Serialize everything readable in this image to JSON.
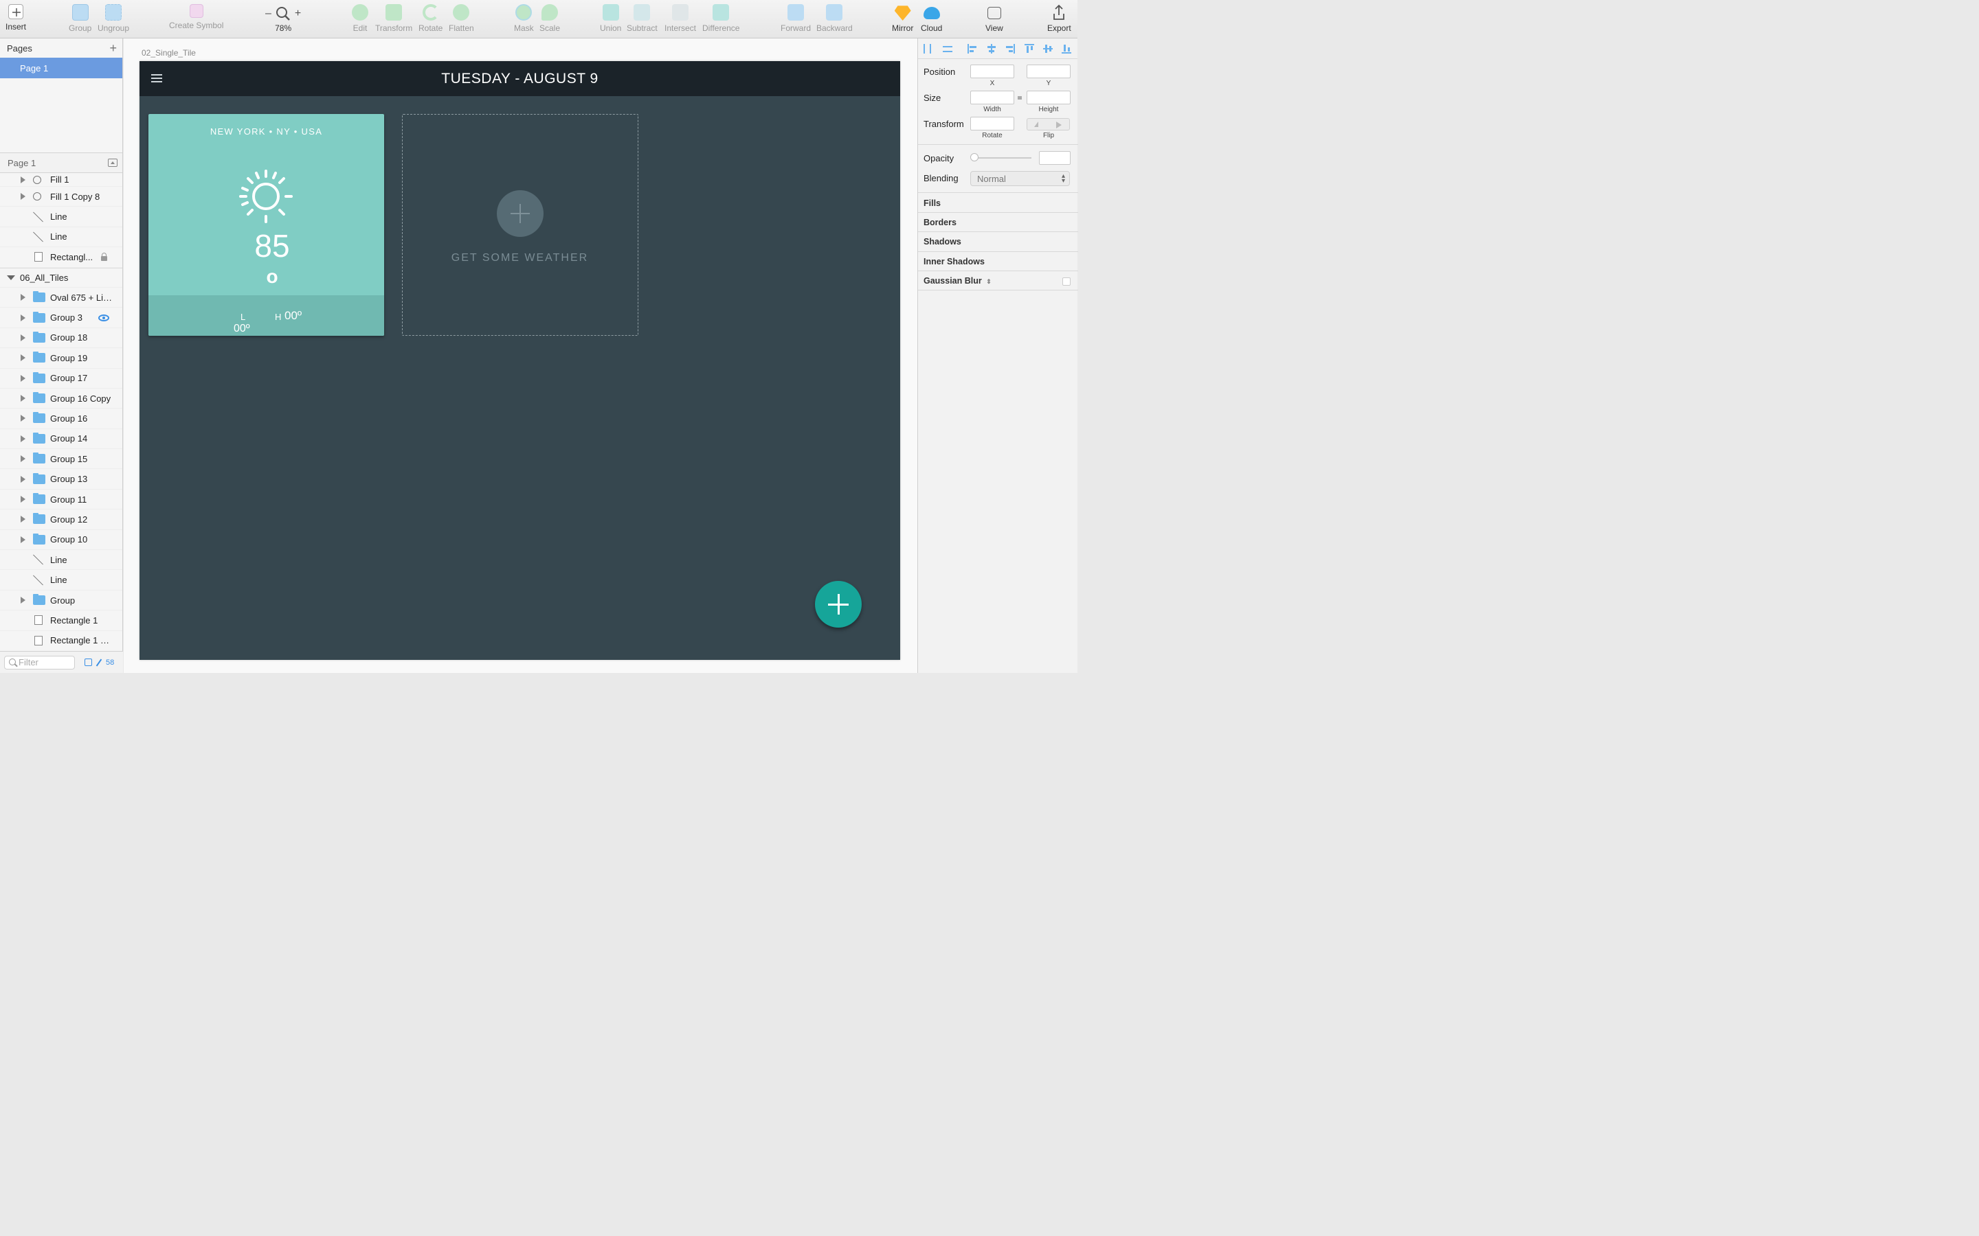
{
  "toolbar": {
    "insert": "Insert",
    "group": "Group",
    "ungroup": "Ungroup",
    "create_symbol": "Create Symbol",
    "zoom_minus": "–",
    "zoom_plus": "+",
    "zoom_level": "78%",
    "edit": "Edit",
    "transform": "Transform",
    "rotate": "Rotate",
    "flatten": "Flatten",
    "mask": "Mask",
    "scale": "Scale",
    "union": "Union",
    "subtract": "Subtract",
    "intersect": "Intersect",
    "difference": "Difference",
    "forward": "Forward",
    "backward": "Backward",
    "mirror": "Mirror",
    "cloud": "Cloud",
    "view": "View",
    "export": "Export"
  },
  "sidebar": {
    "pages_title": "Pages",
    "pages": [
      "Page 1"
    ],
    "layers_header": "Page 1",
    "layers": [
      {
        "name": "Fill 1",
        "icon": "fill-icon"
      },
      {
        "name": "Fill 1 Copy 8",
        "icon": "sun-icon"
      },
      {
        "name": "Line",
        "icon": "line-icon"
      },
      {
        "name": "Line",
        "icon": "line-icon"
      },
      {
        "name": "Rectangl...",
        "icon": "rectangle-icon",
        "locked": true
      },
      {
        "name": "06_All_Tiles",
        "icon": "artboard",
        "expanded": true
      },
      {
        "name": "Oval 675 + Lin...",
        "icon": "folder-icon"
      },
      {
        "name": "Group 3",
        "icon": "folder-icon",
        "visible_toggle": true
      },
      {
        "name": "Group 18",
        "icon": "folder-icon"
      },
      {
        "name": "Group 19",
        "icon": "folder-icon"
      },
      {
        "name": "Group 17",
        "icon": "folder-icon"
      },
      {
        "name": "Group 16 Copy",
        "icon": "folder-icon"
      },
      {
        "name": "Group 16",
        "icon": "folder-icon"
      },
      {
        "name": "Group 14",
        "icon": "folder-icon"
      },
      {
        "name": "Group 15",
        "icon": "folder-icon"
      },
      {
        "name": "Group 13",
        "icon": "folder-icon"
      },
      {
        "name": "Group 11",
        "icon": "folder-icon"
      },
      {
        "name": "Group 12",
        "icon": "folder-icon"
      },
      {
        "name": "Group 10",
        "icon": "folder-icon"
      },
      {
        "name": "Line",
        "icon": "line-icon"
      },
      {
        "name": "Line",
        "icon": "line-icon"
      },
      {
        "name": "Group",
        "icon": "folder-icon"
      },
      {
        "name": "Rectangle 1",
        "icon": "rectangle-icon"
      },
      {
        "name": "Rectangle 1 Co...",
        "icon": "rectangle-icon"
      }
    ],
    "filter_placeholder": "Filter",
    "layer_count": "58"
  },
  "canvas": {
    "artboard_name": "02_Single_Tile",
    "header_title": "TUESDAY  -  AUGUST 9",
    "tile": {
      "location": "NEW YORK  •  NY  •  USA",
      "temperature": "85",
      "degree": "o",
      "low_label": "L",
      "low_value": "00º",
      "high_label": "H",
      "high_value": "00º"
    },
    "empty_tile_text": "GET SOME WEATHER"
  },
  "inspector": {
    "position": "Position",
    "x": "X",
    "y": "Y",
    "size": "Size",
    "width": "Width",
    "height": "Height",
    "transform": "Transform",
    "rotate": "Rotate",
    "flip": "Flip",
    "opacity": "Opacity",
    "blending": "Blending",
    "blending_value": "Normal",
    "fills": "Fills",
    "borders": "Borders",
    "shadows": "Shadows",
    "inner_shadows": "Inner Shadows",
    "gaussian_blur": "Gaussian Blur"
  },
  "colors": {
    "accent": "#16a599",
    "tile": "#80cdc4",
    "artboard": "#36474f",
    "selection": "#6b9be0"
  }
}
